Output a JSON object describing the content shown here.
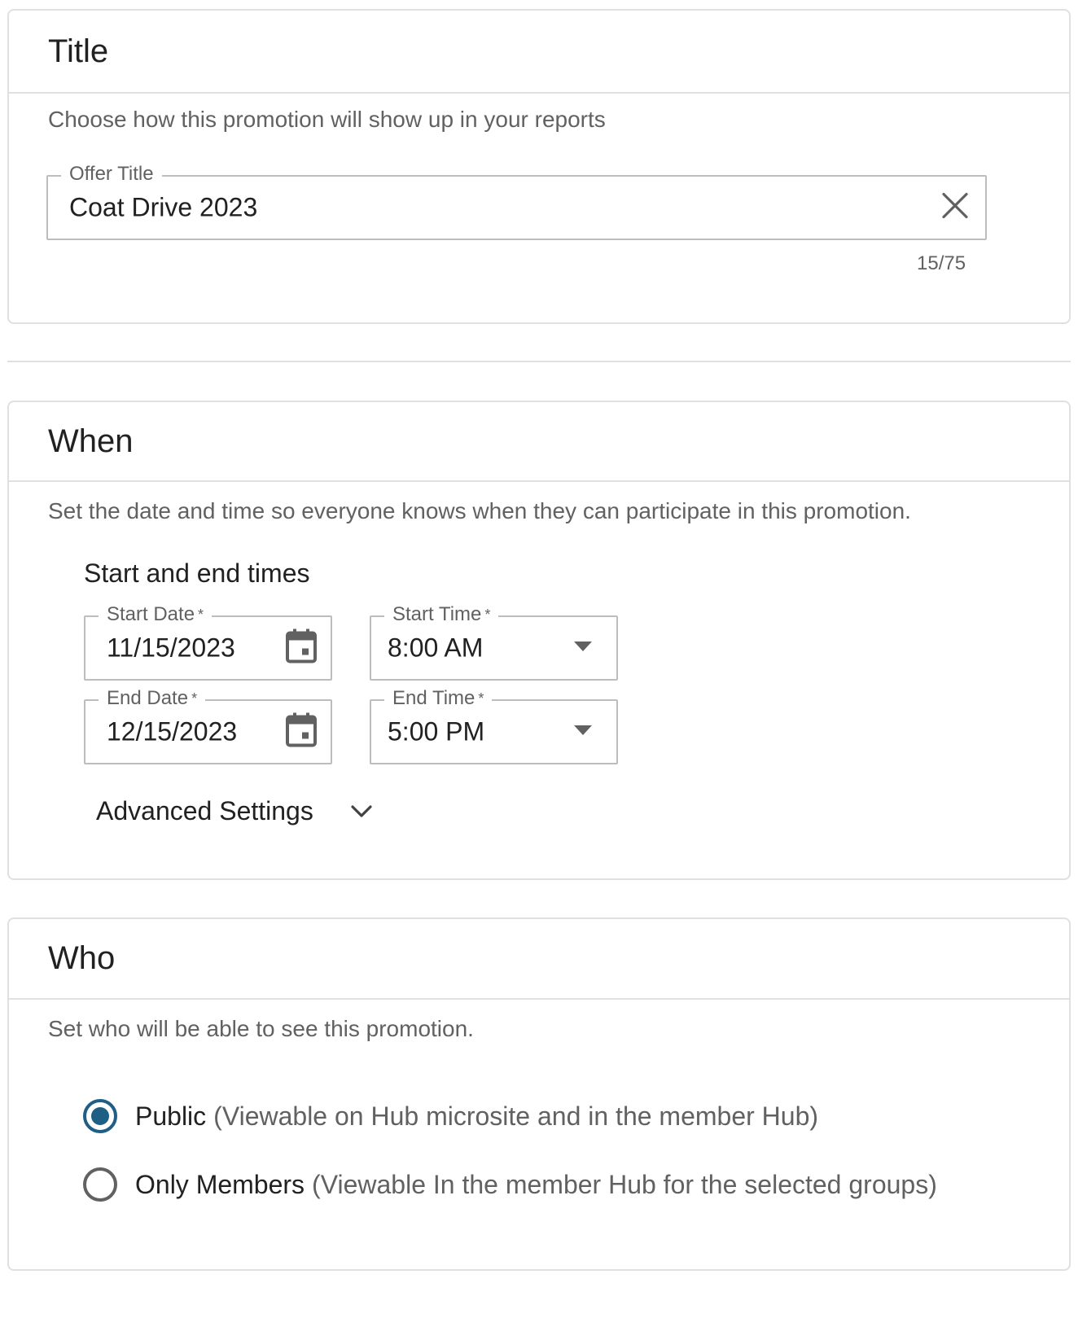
{
  "title_section": {
    "heading": "Title",
    "description": "Choose how this promotion will show up in your reports",
    "offer_title": {
      "label": "Offer Title",
      "value": "Coat Drive 2023",
      "clear_icon": "close-icon"
    },
    "counter": "15/75"
  },
  "when_section": {
    "heading": "When",
    "description": "Set the date and time so everyone knows when they can participate in this promotion.",
    "subheading": "Start and end times",
    "start_date": {
      "label": "Start Date",
      "required_mark": "*",
      "value": "11/15/2023",
      "icon": "calendar-icon"
    },
    "start_time": {
      "label": "Start Time",
      "required_mark": "*",
      "value": "8:00 AM",
      "icon": "dropdown-arrow-icon"
    },
    "end_date": {
      "label": "End Date",
      "required_mark": "*",
      "value": "12/15/2023",
      "icon": "calendar-icon"
    },
    "end_time": {
      "label": "End Time",
      "required_mark": "*",
      "value": "5:00 PM",
      "icon": "dropdown-arrow-icon"
    },
    "advanced_settings": {
      "label": "Advanced Settings",
      "icon": "chevron-down-icon"
    }
  },
  "who_section": {
    "heading": "Who",
    "description": "Set who will be able to see this promotion.",
    "options": [
      {
        "label": "Public",
        "detail": "(Viewable on Hub microsite and in the member Hub)",
        "selected": true
      },
      {
        "label": "Only Members",
        "detail": "(Viewable In the member Hub for the selected groups)",
        "selected": false
      }
    ]
  },
  "colors": {
    "accent": "#1f5f85",
    "border": "#e0e0e0",
    "secondary_text": "#616161"
  }
}
